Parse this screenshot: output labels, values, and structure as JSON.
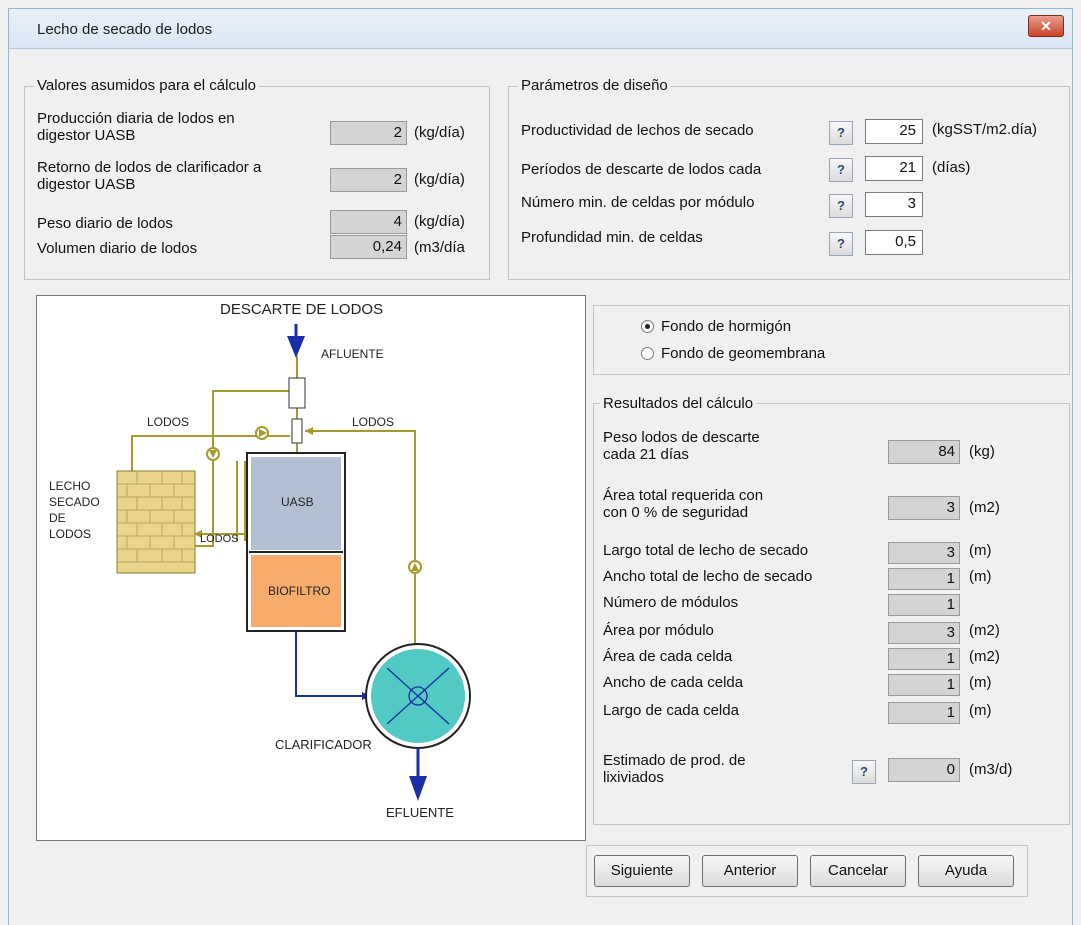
{
  "window": {
    "title": "Lecho de secado de lodos",
    "close_glyph": "✕"
  },
  "assumed": {
    "legend": "Valores asumidos para el cálculo",
    "rows": [
      {
        "label1": "Producción diaria de lodos en",
        "label2": "digestor UASB",
        "value": "2",
        "unit": "(kg/día)"
      },
      {
        "label1": "Retorno de lodos de clarificador a",
        "label2": "digestor UASB",
        "value": "2",
        "unit": "(kg/día)"
      },
      {
        "label1": "Peso diario de lodos",
        "value": "4",
        "unit": "(kg/día)"
      },
      {
        "label1": "Volumen diario de lodos",
        "value": "0,24",
        "unit": "(m3/día"
      }
    ]
  },
  "design": {
    "legend": "Parámetros de diseño",
    "help_label": "?",
    "rows": [
      {
        "label": "Productividad de lechos de secado",
        "value": "25",
        "unit": "(kgSST/m2.día)"
      },
      {
        "label": "Períodos de descarte de lodos cada",
        "value": "21",
        "unit": "(días)"
      },
      {
        "label": "Número min. de celdas por módulo",
        "value": "3",
        "unit": ""
      },
      {
        "label": "Profundidad min. de celdas",
        "value": "0,5",
        "unit": ""
      }
    ]
  },
  "diagram": {
    "descarte": "DESCARTE DE  LODOS",
    "afluente": "AFLUENTE",
    "lodos_left": "LODOS",
    "lodos_right": "LODOS",
    "lodos_small": "LODOS",
    "lecho": [
      "LECHO",
      "SECADO",
      "DE",
      "LODOS"
    ],
    "uasb": "UASB",
    "biofiltro": "BIOFILTRO",
    "clarificador": "CLARIFICADOR",
    "efluente": "EFLUENTE",
    "colors": {
      "flow_line": "#a69a2c",
      "arrow_blue": "#1a2ea8",
      "uasb_fill": "#b3c0d4",
      "biofiltro_fill": "#f5ac6c",
      "brick": "#e8d58a",
      "clarifier": "#52c9c3"
    }
  },
  "options": {
    "concrete": {
      "label": "Fondo de hormigón",
      "selected": true
    },
    "membrane": {
      "label": "Fondo de geomembrana",
      "selected": false
    }
  },
  "results": {
    "legend": "Resultados del cálculo",
    "peso_label1": "Peso lodos de descarte",
    "peso_label2": "cada    21 días",
    "peso_value": "84",
    "peso_unit": "(kg)",
    "area_label1": "Área total requerida con",
    "area_label2": "con    0  % de seguridad",
    "area_value": "3",
    "area_unit": "(m2)",
    "list": [
      {
        "label": "Largo total de lecho de secado",
        "value": "3",
        "unit": "(m)"
      },
      {
        "label": "Ancho total  de lecho de secado",
        "value": "1",
        "unit": "(m)"
      },
      {
        "label": "Número de módulos",
        "value": "1",
        "unit": ""
      },
      {
        "label": "Área por  módulo",
        "value": "3",
        "unit": "(m2)"
      },
      {
        "label": "Área de cada celda",
        "value": "1",
        "unit": "(m2)"
      },
      {
        "label": "Ancho de cada celda",
        "value": "1",
        "unit": "(m)"
      },
      {
        "label": "Largo de cada celda",
        "value": "1",
        "unit": "(m)"
      }
    ],
    "lix_label1": "Estimado de prod. de",
    "lix_label2": "lixiviados",
    "lix_value": "0",
    "lix_unit": "(m3/d)"
  },
  "buttons": {
    "next": "Siguiente",
    "prev": "Anterior",
    "cancel": "Cancelar",
    "help": "Ayuda"
  }
}
